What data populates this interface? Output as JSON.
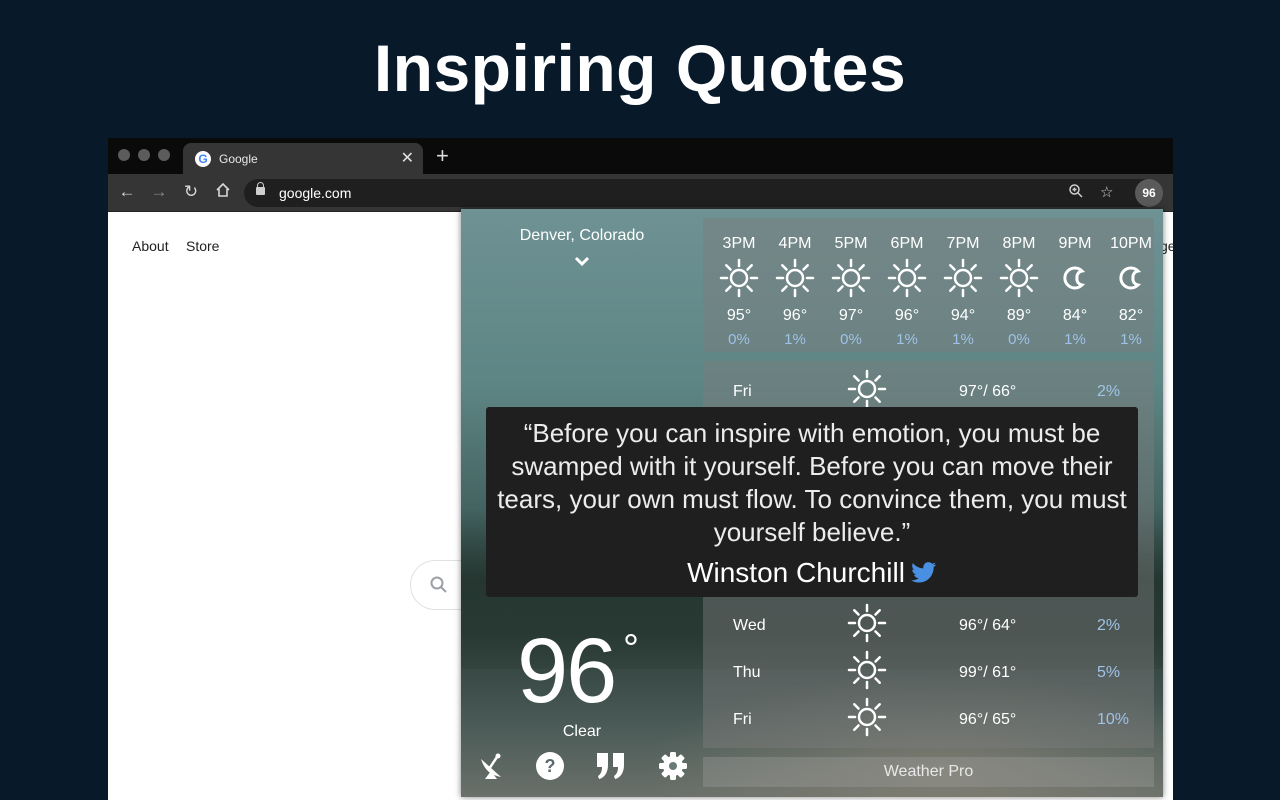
{
  "headline": "Inspiring Quotes",
  "browser": {
    "tab_title": "Google",
    "tab_favicon": "G",
    "url": "google.com",
    "extension_badge": "96"
  },
  "google": {
    "links": [
      "About",
      "Store"
    ],
    "right_fragment": "ge"
  },
  "weather": {
    "location": "Denver, Colorado",
    "current_temp": "96",
    "degree_symbol": "°",
    "condition": "Clear",
    "hourly": [
      {
        "time": "3PM",
        "icon": "sun-icon",
        "temp": "95°",
        "precip": "0%"
      },
      {
        "time": "4PM",
        "icon": "sun-icon",
        "temp": "96°",
        "precip": "1%"
      },
      {
        "time": "5PM",
        "icon": "sun-icon",
        "temp": "97°",
        "precip": "0%"
      },
      {
        "time": "6PM",
        "icon": "sun-icon",
        "temp": "96°",
        "precip": "1%"
      },
      {
        "time": "7PM",
        "icon": "sun-icon",
        "temp": "94°",
        "precip": "1%"
      },
      {
        "time": "8PM",
        "icon": "sun-icon",
        "temp": "89°",
        "precip": "0%"
      },
      {
        "time": "9PM",
        "icon": "moon-icon",
        "temp": "84°",
        "precip": "1%"
      },
      {
        "time": "10PM",
        "icon": "moon-icon",
        "temp": "82°",
        "precip": "1%"
      }
    ],
    "daily": [
      {
        "day": "Fri",
        "icon": "sun-icon",
        "temps": "97°/ 66°",
        "precip": "2%"
      },
      {
        "day": "Wed",
        "icon": "sun-icon",
        "temps": "96°/ 64°",
        "precip": "2%"
      },
      {
        "day": "Thu",
        "icon": "sun-icon",
        "temps": "99°/ 61°",
        "precip": "5%"
      },
      {
        "day": "Fri",
        "icon": "sun-icon",
        "temps": "96°/ 65°",
        "precip": "10%"
      }
    ],
    "footer_label": "Weather Pro"
  },
  "quote": {
    "text": "“Before you can inspire with emotion, you must be swamped with it yourself. Before you can move their tears, your own must flow. To convince them, you must yourself believe.”",
    "author": "Winston Churchill"
  },
  "colors": {
    "page_background": "#08192a",
    "precip_blue": "#9fc2e8",
    "twitter_blue": "#4a90e2"
  }
}
